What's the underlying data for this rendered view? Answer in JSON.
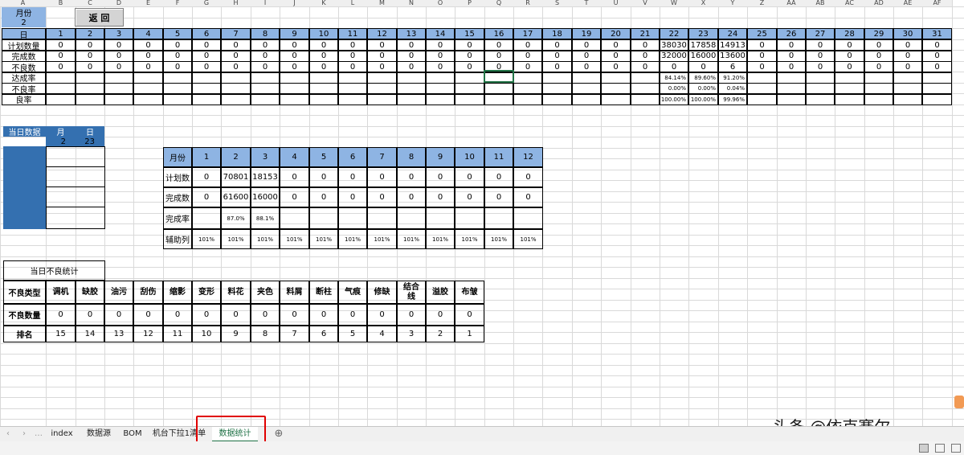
{
  "col_headers": [
    "A",
    "B",
    "C",
    "D",
    "E",
    "F",
    "G",
    "H",
    "I",
    "J",
    "K",
    "L",
    "M",
    "N",
    "O",
    "P",
    "Q",
    "R",
    "S",
    "T",
    "U",
    "V",
    "W",
    "X",
    "Y",
    "Z",
    "AA",
    "AB",
    "AC",
    "AD",
    "AE",
    "AF"
  ],
  "top": {
    "month_label": "月份",
    "month_value": "2",
    "return_button": "返 回",
    "day_label": "日",
    "days": [
      "1",
      "2",
      "3",
      "4",
      "5",
      "6",
      "7",
      "8",
      "9",
      "10",
      "11",
      "12",
      "13",
      "14",
      "15",
      "16",
      "17",
      "18",
      "19",
      "20",
      "21",
      "22",
      "23",
      "24",
      "25",
      "26",
      "27",
      "28",
      "29",
      "30",
      "31"
    ],
    "rows": [
      {
        "label": "计划数量",
        "values": [
          "0",
          "0",
          "0",
          "0",
          "0",
          "0",
          "0",
          "0",
          "0",
          "0",
          "0",
          "0",
          "0",
          "0",
          "0",
          "0",
          "0",
          "0",
          "0",
          "0",
          "0",
          "38030",
          "17858",
          "14913",
          "0",
          "0",
          "0",
          "0",
          "0",
          "0",
          "0"
        ]
      },
      {
        "label": "完成数",
        "values": [
          "0",
          "0",
          "0",
          "0",
          "0",
          "0",
          "0",
          "0",
          "0",
          "0",
          "0",
          "0",
          "0",
          "0",
          "0",
          "0",
          "0",
          "0",
          "0",
          "0",
          "0",
          "32000",
          "16000",
          "13600",
          "0",
          "0",
          "0",
          "0",
          "0",
          "0",
          "0"
        ]
      },
      {
        "label": "不良数",
        "values": [
          "0",
          "0",
          "0",
          "0",
          "0",
          "0",
          "0",
          "0",
          "0",
          "0",
          "0",
          "0",
          "0",
          "0",
          "0",
          "0",
          "0",
          "0",
          "0",
          "0",
          "0",
          "0",
          "0",
          "6",
          "0",
          "0",
          "0",
          "0",
          "0",
          "0",
          "0"
        ]
      },
      {
        "label": "达成率",
        "values": [
          "",
          "",
          "",
          "",
          "",
          "",
          "",
          "",
          "",
          "",
          "",
          "",
          "",
          "",
          "",
          "",
          "",
          "",
          "",
          "",
          "",
          "84.14%",
          "89.60%",
          "91.20%",
          "",
          "",
          "",
          "",
          "",
          "",
          ""
        ]
      },
      {
        "label": "不良率",
        "values": [
          "",
          "",
          "",
          "",
          "",
          "",
          "",
          "",
          "",
          "",
          "",
          "",
          "",
          "",
          "",
          "",
          "",
          "",
          "",
          "",
          "",
          "0.00%",
          "0.00%",
          "0.04%",
          "",
          "",
          "",
          "",
          "",
          "",
          ""
        ]
      },
      {
        "label": "良率",
        "values": [
          "",
          "",
          "",
          "",
          "",
          "",
          "",
          "",
          "",
          "",
          "",
          "",
          "",
          "",
          "",
          "",
          "",
          "",
          "",
          "",
          "",
          "100.00%",
          "100.00%",
          "99.96%",
          "",
          "",
          "",
          "",
          "",
          "",
          ""
        ]
      }
    ]
  },
  "today": {
    "title": "当日数据",
    "month_label": "月",
    "day_label": "日",
    "month": "2",
    "day": "23"
  },
  "monthly": {
    "header_label": "月份",
    "months": [
      "1",
      "2",
      "3",
      "4",
      "5",
      "6",
      "7",
      "8",
      "9",
      "10",
      "11",
      "12"
    ],
    "rows": [
      {
        "label": "计划数",
        "values": [
          "0",
          "70801",
          "18153",
          "0",
          "0",
          "0",
          "0",
          "0",
          "0",
          "0",
          "0",
          "0"
        ]
      },
      {
        "label": "完成数",
        "values": [
          "0",
          "61600",
          "16000",
          "0",
          "0",
          "0",
          "0",
          "0",
          "0",
          "0",
          "0",
          "0"
        ]
      },
      {
        "label": "完成率",
        "values": [
          "",
          "87.0%",
          "88.1%",
          "",
          "",
          "",
          "",
          "",
          "",
          "",
          "",
          ""
        ]
      },
      {
        "label": "辅助列",
        "values": [
          "101%",
          "101%",
          "101%",
          "101%",
          "101%",
          "101%",
          "101%",
          "101%",
          "101%",
          "101%",
          "101%",
          "101%"
        ]
      }
    ]
  },
  "defects": {
    "title": "当日不良统计",
    "type_label": "不良类型",
    "qty_label": "不良数量",
    "rank_label": "排名",
    "types": [
      "调机",
      "缺胶",
      "油污",
      "刮伤",
      "缩影",
      "变形",
      "料花",
      "夹色",
      "料屑",
      "断柱",
      "气痕",
      "修缺",
      "结合线",
      "溢胶",
      "布皱"
    ],
    "qty": [
      "0",
      "0",
      "0",
      "0",
      "0",
      "0",
      "0",
      "0",
      "0",
      "0",
      "0",
      "0",
      "0",
      "0",
      "0"
    ],
    "rank": [
      "15",
      "14",
      "13",
      "12",
      "11",
      "10",
      "9",
      "8",
      "7",
      "6",
      "5",
      "4",
      "3",
      "2",
      "1"
    ]
  },
  "sheet_tabs": [
    "index",
    "数据源",
    "BOM",
    "机台下拉1清单",
    "数据统计"
  ],
  "active_tab": "数据统计",
  "watermark": "头条 @依克赛尔",
  "colors": {
    "header_blue": "#8eb4e3",
    "dark_blue": "#3470b0",
    "excel_green": "#217346",
    "highlight_red": "#e00000"
  }
}
